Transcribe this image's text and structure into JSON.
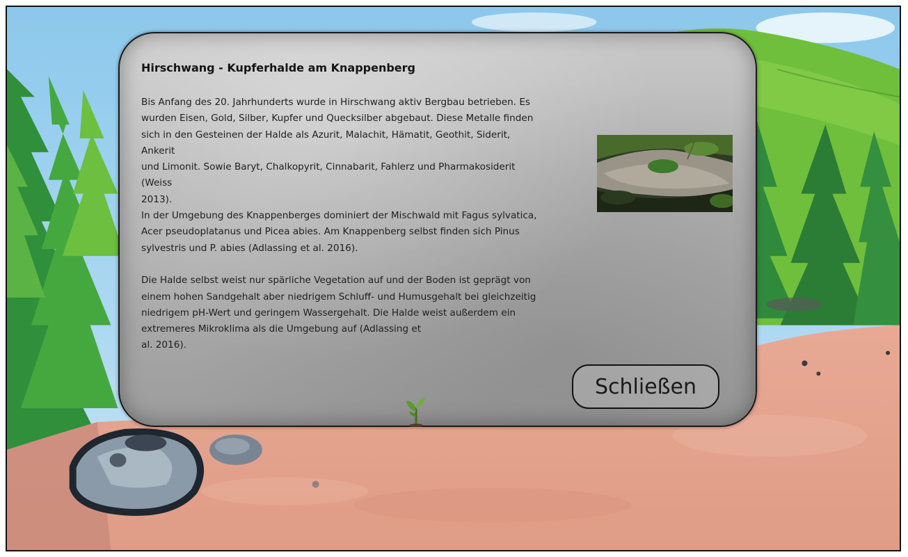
{
  "dialog": {
    "title": "Hirschwang - Kupferhalde am Knappenberg",
    "paragraph_lines": [
      "Bis Anfang des 20. Jahrhunderts wurde in Hirschwang aktiv Bergbau betrieben. Es",
      "wurden Eisen, Gold, Silber, Kupfer und Quecksilber abgebaut. Diese Metalle finden",
      "sich in den Gesteinen der Halde als Azurit, Malachit, Hämatit, Geothit, Siderit,",
      "Ankerit",
      "und Limonit. Sowie Baryt, Chalkopyrit, Cinnabarit, Fahlerz und Pharmakosiderit",
      "(Weiss",
      "2013).",
      "In der Umgebung des Knappenberges dominiert der Mischwald mit Fagus sylvatica,",
      "Acer pseudoplatanus und Picea abies. Am Knappenberg selbst finden sich Pinus",
      "sylvestris und P. abies (Adlassing et al. 2016)."
    ],
    "paragraph2_lines": [
      "Die Halde selbst weist nur spärliche Vegetation auf und der Boden ist geprägt von",
      "einem hohen Sandgehalt aber niedrigem Schluff- und Humusgehalt bei gleichzeitig",
      "niedrigem pH-Wert und geringem Wassergehalt. Die Halde weist außerdem ein",
      "extremeres Mikroklima als die Umgebung auf (Adlassing et",
      "al. 2016)."
    ],
    "close_label": "Schließen"
  },
  "colors": {
    "sky": "#9fd0ee",
    "ground": "#e3a089",
    "forest": "#2f8f3a",
    "meadow": "#7cc241",
    "dialog_bg": "#b5b5b5",
    "text": "#1e1e1e"
  },
  "icons": [
    "sprout-icon"
  ]
}
